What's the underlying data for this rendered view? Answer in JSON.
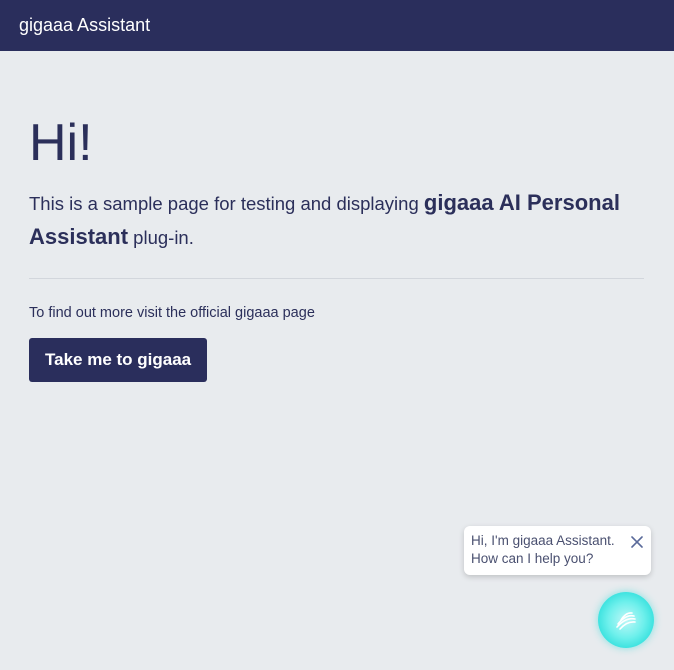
{
  "navbar": {
    "brand": "gigaaa Assistant"
  },
  "hero": {
    "title": "Hi!",
    "lead_prefix": "This is a sample page for testing and displaying ",
    "lead_strong": "gigaaa AI Personal Assistant",
    "lead_suffix": " plug-in."
  },
  "info": {
    "text": "To find out more visit the official gigaaa page"
  },
  "cta": {
    "label": "Take me to gigaaa"
  },
  "assistant": {
    "greeting_line1": "Hi, I'm gigaaa Assistant.",
    "greeting_line2": "How can I help you?",
    "close_icon": "close-icon",
    "launcher_icon": "gigaaa-orb-icon"
  },
  "colors": {
    "navbar": "#2a2e5c",
    "background": "#e8ebee",
    "text": "#2b2f5a",
    "orb": "#6ff0ec"
  }
}
